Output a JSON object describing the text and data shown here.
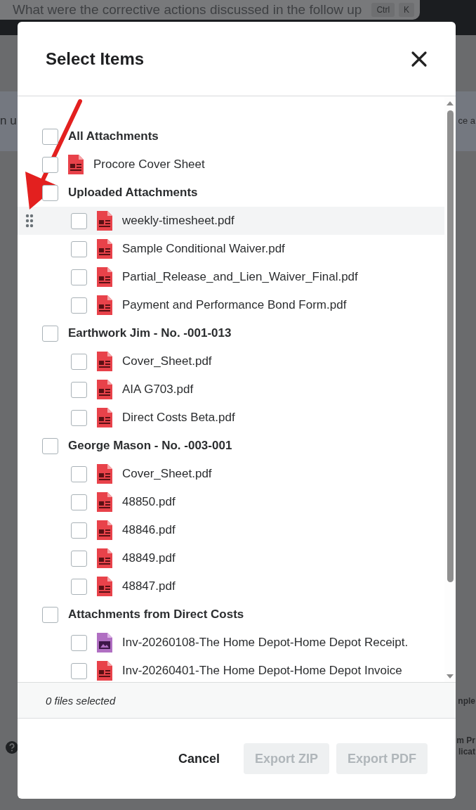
{
  "background": {
    "search_text": "What were the corrective actions discussed in the follow up",
    "shortcut_keys": [
      "Ctrl",
      "K"
    ],
    "fragments": [
      "n u",
      "ce a",
      "nple",
      "m Pr",
      "licat"
    ]
  },
  "dialog": {
    "title": "Select Items",
    "items": [
      {
        "kind": "group",
        "label": "All Attachments",
        "checked": false
      },
      {
        "kind": "pdf",
        "label": "Procore Cover Sheet",
        "checked": false
      },
      {
        "kind": "group",
        "label": "Uploaded Attachments",
        "checked": false,
        "children": [
          {
            "kind": "pdf",
            "label": "weekly-timesheet.pdf",
            "checked": false,
            "hovered": true
          },
          {
            "kind": "pdf",
            "label": "Sample Conditional Waiver.pdf",
            "checked": false,
            "hovered": false
          },
          {
            "kind": "pdf",
            "label": "Partial_Release_and_Lien_Waiver_Final.pdf",
            "checked": false,
            "hovered": false
          },
          {
            "kind": "pdf",
            "label": "Payment and Performance Bond Form.pdf",
            "checked": false,
            "hovered": false
          }
        ]
      },
      {
        "kind": "group",
        "label": "Earthwork Jim - No. -001-013",
        "checked": false,
        "children": [
          {
            "kind": "pdf",
            "label": "Cover_Sheet.pdf",
            "checked": false,
            "hovered": false
          },
          {
            "kind": "pdf",
            "label": "AIA G703.pdf",
            "checked": false,
            "hovered": false
          },
          {
            "kind": "pdf",
            "label": "Direct Costs Beta.pdf",
            "checked": false,
            "hovered": false
          }
        ]
      },
      {
        "kind": "group",
        "label": "George Mason - No. -003-001",
        "checked": false,
        "children": [
          {
            "kind": "pdf",
            "label": "Cover_Sheet.pdf",
            "checked": false,
            "hovered": false
          },
          {
            "kind": "pdf",
            "label": "48850.pdf",
            "checked": false,
            "hovered": false
          },
          {
            "kind": "pdf",
            "label": "48846.pdf",
            "checked": false,
            "hovered": false
          },
          {
            "kind": "pdf",
            "label": "48849.pdf",
            "checked": false,
            "hovered": false
          },
          {
            "kind": "pdf",
            "label": "48847.pdf",
            "checked": false,
            "hovered": false
          }
        ]
      },
      {
        "kind": "group",
        "label": "Attachments from Direct Costs",
        "checked": false,
        "children": [
          {
            "kind": "image",
            "label": "Inv-20260108-The Home Depot-Home Depot Receipt.",
            "checked": false,
            "hovered": false
          },
          {
            "kind": "pdf",
            "label": "Inv-20260401-The Home Depot-Home Depot Invoice",
            "checked": false,
            "hovered": false
          }
        ]
      }
    ],
    "status": "0 files selected",
    "buttons": [
      {
        "label": "Cancel",
        "kind": "text",
        "disabled": false
      },
      {
        "label": "Export ZIP",
        "kind": "filled",
        "disabled": true
      },
      {
        "label": "Export PDF",
        "kind": "filled",
        "disabled": true
      }
    ]
  },
  "annotation": {
    "kind": "arrow"
  }
}
